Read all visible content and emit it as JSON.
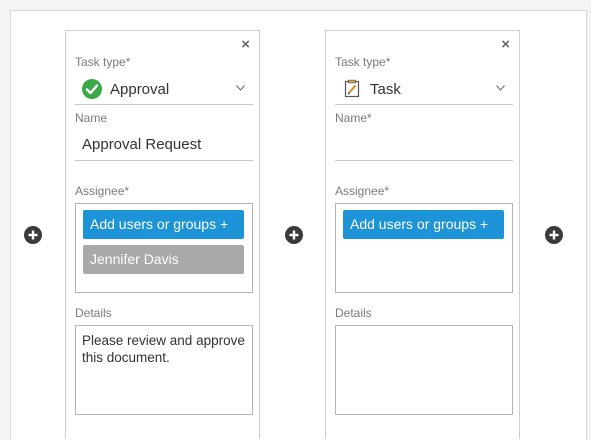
{
  "cards": [
    {
      "close_label": "×",
      "task_type_label": "Task type*",
      "task_type_value": "Approval",
      "task_type_icon": "check-circle-icon",
      "name_label": "Name",
      "name_value": "Approval Request",
      "assignee_label": "Assignee*",
      "add_users_label": "Add users or groups +",
      "assignees": [
        "Jennifer Davis"
      ],
      "details_label": "Details",
      "details_value": "Please review and approve this document."
    },
    {
      "close_label": "×",
      "task_type_label": "Task type*",
      "task_type_value": "Task",
      "task_type_icon": "task-note-icon",
      "name_label": "Name*",
      "name_value": "",
      "assignee_label": "Assignee*",
      "add_users_label": "Add users or groups +",
      "assignees": [],
      "details_label": "Details",
      "details_value": ""
    }
  ],
  "colors": {
    "accent": "#1d94d8",
    "chip": "#a9a9a9",
    "approval_green": "#3aa849",
    "add_step_icon": "#3a3a3a"
  }
}
